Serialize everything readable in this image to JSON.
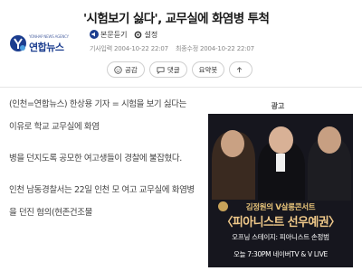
{
  "brand": {
    "name": "연합뉴스",
    "tagline": "YONHAP NEWS AGENCY",
    "color": "#1b3d8f",
    "accent": "#4b9fe0"
  },
  "article": {
    "title": "'시험보기 싫다', 교무실에 화염병 투척",
    "tools": {
      "original_label": "본문듣기",
      "settings_label": "설정"
    },
    "meta": {
      "published": "기사입력 2004-10-22 22:07",
      "modified": "최종수정 2004-10-22 22:07"
    },
    "actions": {
      "like_label": "공감",
      "comment_label": "댓글",
      "summary_label": "요약봇"
    },
    "paragraphs": [
      "(인천=연합뉴스) 한상용 기자 = 시험을 보기 싫다는 이유로 학교 교무실에 화염",
      "병을 던지도록 공모한 여고생들이 경찰에 불잡혔다.",
      "인천 남동경찰서는 22일 인천 모 여고 교무실에 화염병을 던진 혐의(현존건조물"
    ]
  },
  "ad": {
    "label": "광고",
    "line1": "김정원의 V살롱콘서트",
    "line2": "〈피아니스트 선우예권〉",
    "line3": "오프닝 스테이지: 피아니스트 손정범",
    "line4": "오늘 7:30PM 네이버TV & V LIVE"
  }
}
